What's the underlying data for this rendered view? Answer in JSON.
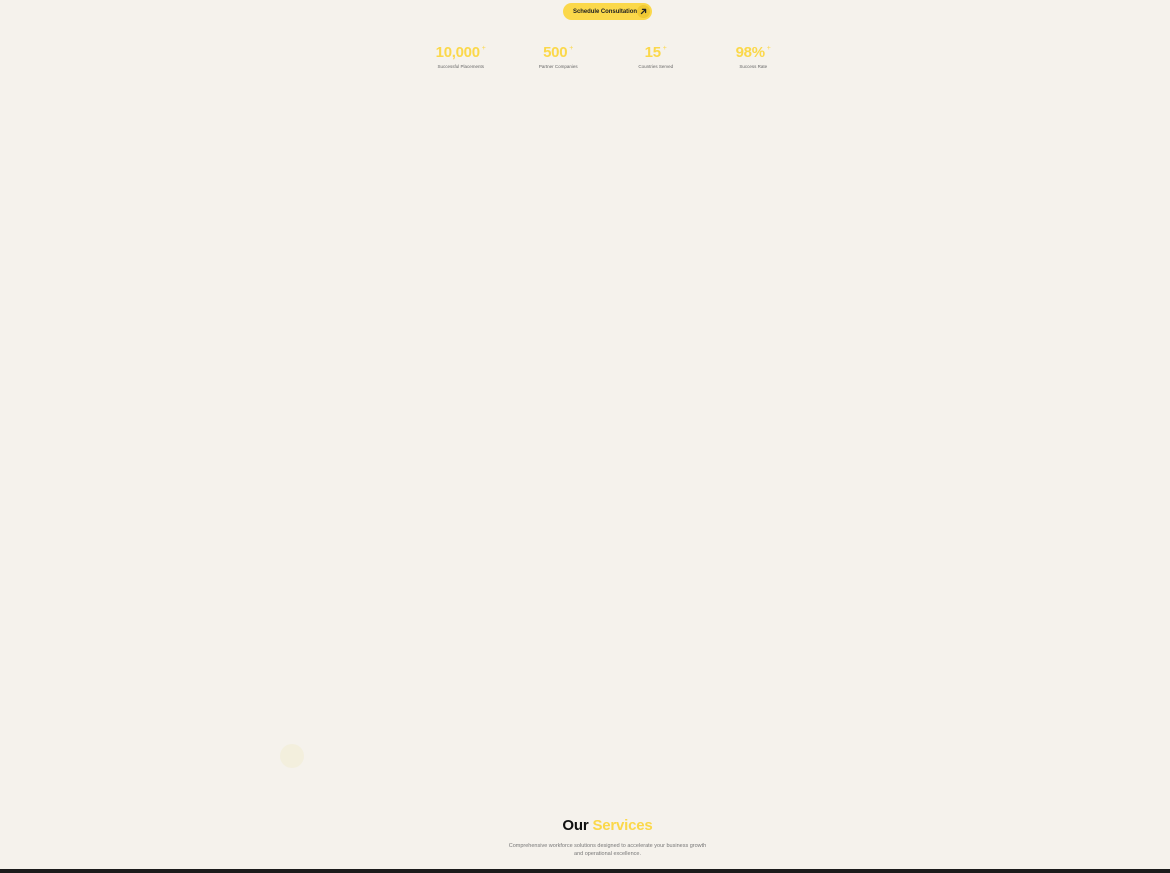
{
  "cta": {
    "label": "Schedule Consultation",
    "icon": "arrow-up-right-icon",
    "color": "#fbd84a"
  },
  "stats": [
    {
      "value": "10,000",
      "suffix": "+",
      "label": "Successful Placements"
    },
    {
      "value": "500",
      "suffix": "+",
      "label": "Partner Companies"
    },
    {
      "value": "15",
      "suffix": "+",
      "label": "Countries Served"
    },
    {
      "value": "98%",
      "suffix": "+",
      "label": "Success Rate"
    }
  ],
  "services": {
    "heading_part1": "Our",
    "heading_part2": "Services",
    "subtitle_line1": "Comprehensive workforce solutions designed to accelerate your business growth",
    "subtitle_line2": "and operational excellence."
  },
  "colors": {
    "accent": "#fbd84a",
    "background": "#f5f2ec",
    "footer": "#1b1b1b"
  }
}
